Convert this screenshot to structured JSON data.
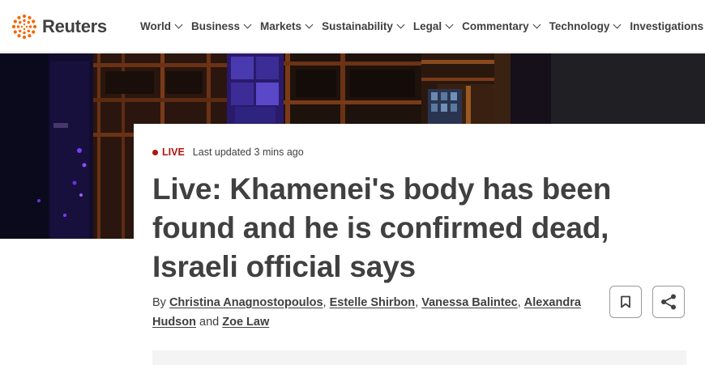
{
  "header": {
    "logo_text": "Reuters",
    "brand_color": "#fa6400",
    "nav": [
      {
        "label": "World",
        "has_dropdown": true
      },
      {
        "label": "Business",
        "has_dropdown": true
      },
      {
        "label": "Markets",
        "has_dropdown": true
      },
      {
        "label": "Sustainability",
        "has_dropdown": true
      },
      {
        "label": "Legal",
        "has_dropdown": true
      },
      {
        "label": "Commentary",
        "has_dropdown": true
      },
      {
        "label": "Technology",
        "has_dropdown": true
      },
      {
        "label": "Investigations",
        "has_dropdown": false
      }
    ]
  },
  "article": {
    "live_label": "LIVE",
    "live_color": "#b1150e",
    "updated": "Last updated 3 mins ago",
    "headline": "Live: Khamenei's body has been found and he is confirmed dead, Israeli official says",
    "byline_prefix": "By",
    "authors": [
      "Christina Anagnostopoulos",
      "Estelle Shirbon",
      "Vanessa Balintec",
      "Alexandra Hudson",
      "Zoe Law"
    ],
    "sep_comma": ",",
    "sep_and": "and"
  },
  "actions": {
    "bookmark_icon": "bookmark-icon",
    "share_icon": "share-icon"
  }
}
